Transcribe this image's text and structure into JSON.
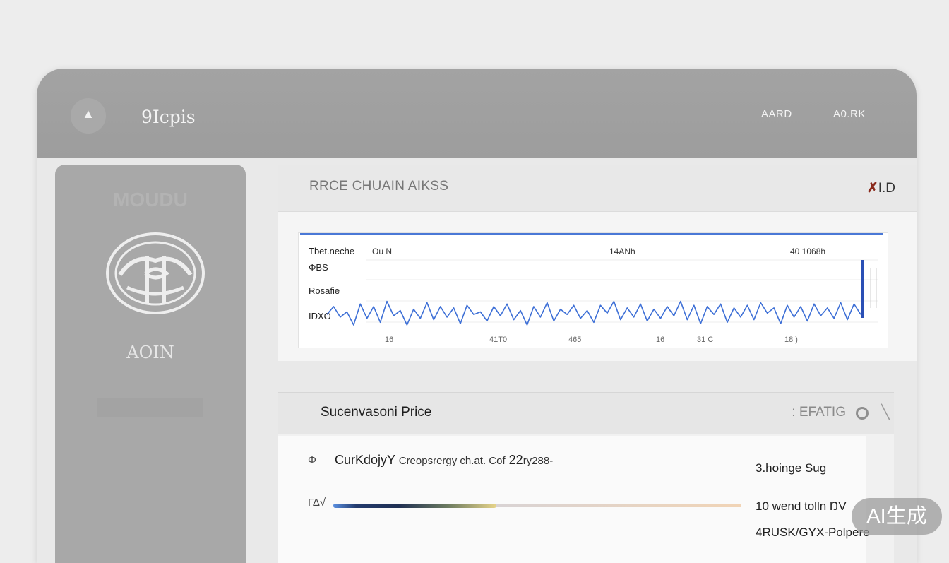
{
  "header": {
    "brand": "9Icpis",
    "logo_icon": "chevron-up-icon",
    "nav": [
      "AARD",
      "A0.RK"
    ]
  },
  "sidebar": {
    "top_text": "MOUDU",
    "emblem_icon": "emblem-icon",
    "label": "AOIN"
  },
  "chart_panel": {
    "title": "RRCE CHUAIN AIKSS",
    "close_label": "I.D",
    "close_icon": "close-icon"
  },
  "chart_data": {
    "type": "line",
    "row_labels": [
      "Tbet.neche",
      "ΦBS",
      "Rosafie",
      "IDXO"
    ],
    "top_labels": [
      "Ou N",
      "14ANh",
      "40 1068h"
    ],
    "x_tick_labels": [
      "16",
      "41T0",
      "465",
      "16",
      "31 C",
      "18 )"
    ],
    "series": [
      {
        "color": "#3d6fd6",
        "values": [
          44,
          56,
          40,
          48,
          28,
          60,
          38,
          56,
          32,
          64,
          42,
          50,
          28,
          52,
          38,
          62,
          36,
          56,
          40,
          54,
          30,
          58,
          44,
          48,
          34,
          56,
          42,
          60,
          36,
          50,
          28,
          56,
          40,
          62,
          34,
          52,
          44,
          58,
          38,
          50,
          32,
          58,
          46,
          64,
          36,
          54,
          40,
          60,
          34,
          52,
          38,
          56,
          42,
          64,
          36,
          58,
          30,
          56,
          44,
          60,
          32,
          54,
          40,
          58,
          36,
          62,
          46,
          54,
          30,
          58,
          40,
          56,
          34,
          60,
          42,
          54,
          38,
          62,
          36,
          60,
          44
        ]
      }
    ],
    "ylim": [
      0,
      100
    ]
  },
  "list_panel": {
    "title": "Sucenvasoni Price",
    "status": "EFATIG",
    "status_prefix": ":",
    "status_icon": "circle-icon",
    "extra_icon": "slash-icon",
    "rows": [
      {
        "icon": "Φ",
        "main": "CurKdojyY",
        "detail": "Creopsrergy ch.at. Cof",
        "suffix": "22",
        "suffix2": "ry288-",
        "right": "3.hoinge Sug"
      },
      {
        "icon": "ΓΔ√",
        "progress": 0.4,
        "right": "10 wend tolln ŊV"
      },
      {
        "right": "4RUSK/GYX-Polpere"
      }
    ]
  },
  "badge": "AI生成",
  "colors": {
    "topbar": "#a0a0a0",
    "sidebar": "#a8a8a8",
    "chart_line": "#3d6fd6",
    "accent_bar": "#2a4fb5"
  }
}
